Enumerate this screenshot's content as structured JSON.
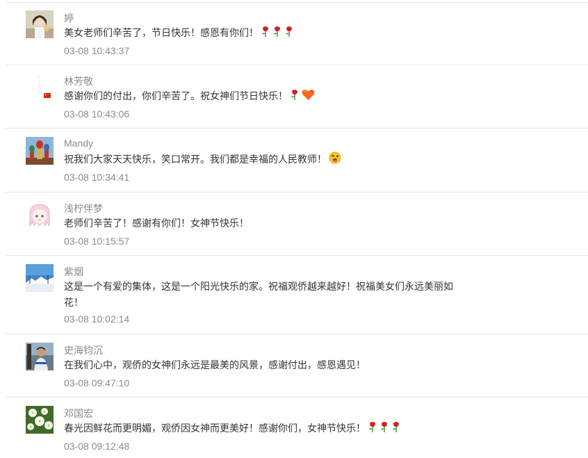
{
  "comments": [
    {
      "name": "婷",
      "text": "美女老师们辛苦了，节日快乐！感恩有你们！",
      "emojis": [
        "rose",
        "rose",
        "rose"
      ],
      "time": "03-08 10:43:37"
    },
    {
      "name": "林芳敬",
      "text": "感谢你们的付出，你们辛苦了。祝女神们节日快乐！",
      "emojis": [
        "rose",
        "heart"
      ],
      "time": "03-08 10:43:06"
    },
    {
      "name": "Mandy",
      "text": "祝我们大家天天快乐，笑口常开。我们都是幸福的人民教师！",
      "emojis": [
        "wink-tongue"
      ],
      "time": "03-08 10:34:41"
    },
    {
      "name": "浅柠伴梦",
      "text": "老师们辛苦了！感谢有你们！女神节快乐！",
      "emojis": [],
      "time": "03-08 10:15:57"
    },
    {
      "name": "紫烟",
      "text": "这是一个有爱的集体，这是一个阳光快乐的家。祝福观侨越来越好！祝福美女们永远美丽如花！",
      "emojis": [],
      "time": "03-08 10:02:14"
    },
    {
      "name": "史海钧沉",
      "text": "在我们心中，观侨的女神们永远是最美的风景，感谢付出，感恩遇见！",
      "emojis": [],
      "time": "03-08 09:47:10"
    },
    {
      "name": "邓国宏",
      "text": "春光因鲜花而更明媚，观侨因女神而更美好！感谢你们，女神节快乐！",
      "emojis": [
        "rose",
        "rose",
        "rose"
      ],
      "time": "03-08 09:12:48"
    }
  ]
}
